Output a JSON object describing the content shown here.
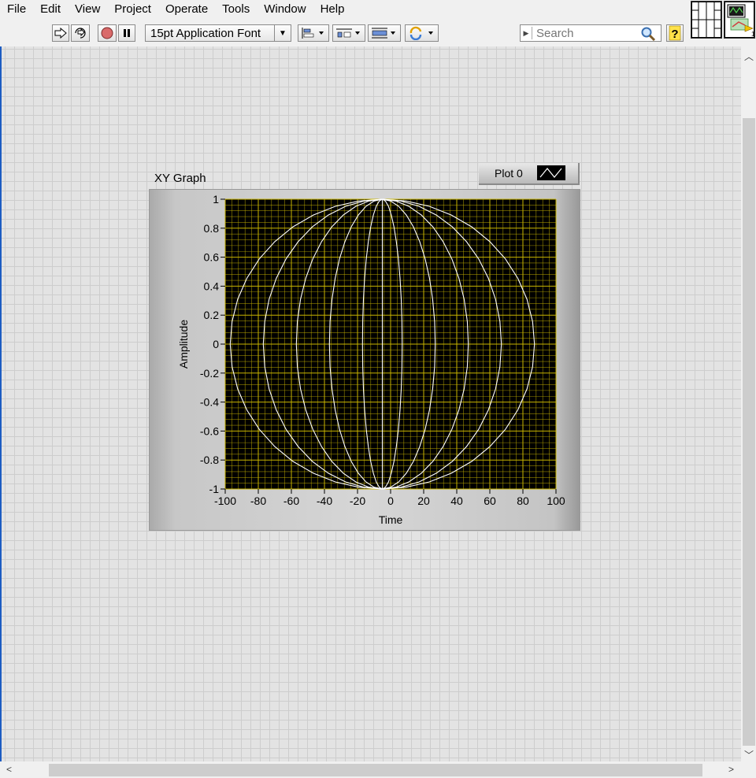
{
  "menu": [
    "File",
    "Edit",
    "View",
    "Project",
    "Operate",
    "Tools",
    "Window",
    "Help"
  ],
  "toolbar": {
    "font_label": "15pt Application Font",
    "search_placeholder": "Search"
  },
  "icons": [
    "run-arrow-icon",
    "run-continuously-icon",
    "abort-icon",
    "pause-icon",
    "align-icon",
    "distribute-icon",
    "resize-icon",
    "reorder-icon",
    "search-icon",
    "help-icon",
    "connector-pane-icon",
    "vi-icon"
  ],
  "graph": {
    "label": "XY Graph",
    "legend_label": "Plot 0",
    "plot_background": "#000000",
    "grid_color": "#c8b400",
    "trace_color": "#ffffff"
  },
  "chart_data": {
    "type": "line",
    "title": "XY Graph",
    "xlabel": "Time",
    "ylabel": "Amplitude",
    "xlim": [
      -100,
      100
    ],
    "ylim": [
      -1,
      1
    ],
    "x_ticks": [
      "-100",
      "-80",
      "-60",
      "-40",
      "-20",
      "0",
      "20",
      "40",
      "60",
      "80",
      "100"
    ],
    "y_ticks": [
      "1",
      "0.8",
      "0.6",
      "0.4",
      "0.2",
      "0",
      "-0.2",
      "-0.4",
      "-0.6",
      "-0.8",
      "-1"
    ],
    "grid": true,
    "legend": "top-right",
    "series": [
      {
        "name": "Plot 0",
        "type": "ellipse-arcs",
        "x_radii": [
          92,
          72,
          52,
          32,
          12,
          -12,
          -32,
          -52,
          -72,
          -92
        ],
        "x_center": -5,
        "points_per_arc": 20
      }
    ]
  }
}
